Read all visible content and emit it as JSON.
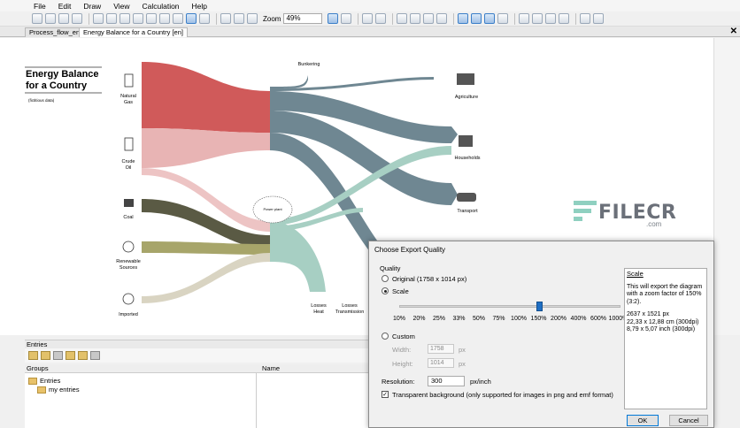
{
  "menu": [
    "File",
    "Edit",
    "Draw",
    "View",
    "Calculation",
    "Help"
  ],
  "toolbar": {
    "zoom_label": "Zoom",
    "zoom_value": "49%"
  },
  "tabs": [
    {
      "label": "Process_flow_en",
      "active": false
    },
    {
      "label": "Energy Balance for a Country [en]",
      "active": true
    }
  ],
  "diagram": {
    "title": "Energy Balance for a Country",
    "subtitle": "(fictitious data)",
    "center_node": "Power plant",
    "sources": [
      {
        "label": "Natural Gas",
        "color": "#d05a5a"
      },
      {
        "label": "Crude Oil",
        "color": "#e8b4b4"
      },
      {
        "label": "Coal",
        "color": "#5a5a44"
      },
      {
        "label": "Renewable Sources",
        "color": "#a7a56a"
      },
      {
        "label": "Imported",
        "color": "#d9d4c2"
      }
    ],
    "sinks": [
      {
        "label": "Bunkering"
      },
      {
        "label": "Agriculture"
      },
      {
        "label": "Households"
      },
      {
        "label": "Transport"
      },
      {
        "label": "Losses Heat"
      },
      {
        "label": "Losses Transmission"
      }
    ],
    "flow_color": "#6f8792",
    "green_flow_color": "#a7cfc3"
  },
  "entries_panel": {
    "title": "Entries",
    "groups_header": "Groups",
    "name_header": "Name",
    "tree": [
      "Entries",
      "my entries"
    ]
  },
  "dialog": {
    "title": "Choose Export Quality",
    "quality_label": "Quality",
    "original_label": "Original (1758 x 1014 px)",
    "scale_label": "Scale",
    "scale_ticks": [
      "10%",
      "20%",
      "25%",
      "33%",
      "50%",
      "75%",
      "100%",
      "150%",
      "200%",
      "400%",
      "600%",
      "1000%"
    ],
    "scale_value_percent": 150,
    "custom_label": "Custom",
    "width_label": "Width:",
    "width_value": "1758",
    "height_label": "Height:",
    "height_value": "1014",
    "unit": "px",
    "resolution_label": "Resolution:",
    "resolution_value": "300",
    "resolution_unit": "px/inch",
    "transparent_label": "Transparent background (only supported for images in png and emf format)",
    "info_title": "Scale",
    "info_text": "This will export the diagram with a zoom factor of 150% (3:2).",
    "info_px": "2637 x 1521 px",
    "info_cm": "22,33 x 12,88 cm (300dpi)",
    "info_inch": "8,79 x 5,07 inch (300dpi)",
    "ok_label": "OK",
    "cancel_label": "Cancel"
  },
  "watermark": {
    "text": "FILECR",
    "suffix": ".com"
  }
}
